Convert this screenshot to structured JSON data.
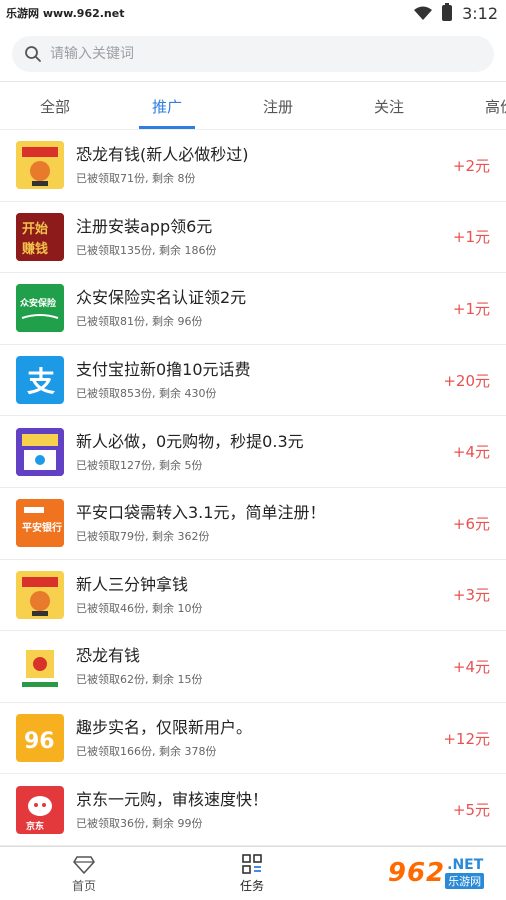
{
  "status": {
    "watermark_left": "乐游网 www.962.net",
    "time": "3:12"
  },
  "search": {
    "placeholder": "请输入关键词"
  },
  "tabs": [
    {
      "label": "全部"
    },
    {
      "label": "推广"
    },
    {
      "label": "注册"
    },
    {
      "label": "关注"
    },
    {
      "label": "高价"
    }
  ],
  "items": [
    {
      "title": "恐龙有钱(新人必做秒过)",
      "sub": "已被领取71份, 剩余 8份",
      "reward": "+2元",
      "thumb": "dino-icon"
    },
    {
      "title": "注册安装app领6元",
      "sub": "已被领取135份, 剩余 186份",
      "reward": "+1元",
      "thumb": "kaishi-icon"
    },
    {
      "title": "众安保险实名认证领2元",
      "sub": "已被领取81份, 剩余 96份",
      "reward": "+1元",
      "thumb": "zhongan-icon"
    },
    {
      "title": "支付宝拉新0撸10元话费",
      "sub": "已被领取853份, 剩余 430份",
      "reward": "+20元",
      "thumb": "alipay-icon"
    },
    {
      "title": "新人必做，0元购物，秒提0.3元",
      "sub": "已被领取127份, 剩余 5份",
      "reward": "+4元",
      "thumb": "shop-icon"
    },
    {
      "title": "平安口袋需转入3.1元，简单注册！",
      "sub": "已被领取79份, 剩余 362份",
      "reward": "+6元",
      "thumb": "pingan-icon"
    },
    {
      "title": "新人三分钟拿钱",
      "sub": "已被领取46份, 剩余 10份",
      "reward": "+3元",
      "thumb": "dino-icon"
    },
    {
      "title": "恐龙有钱",
      "sub": "已被领取62份, 剩余 15份",
      "reward": "+4元",
      "thumb": "dino-icon"
    },
    {
      "title": "趣步实名，仅限新用户。",
      "sub": "已被领取166份, 剩余 378份",
      "reward": "+12元",
      "thumb": "qubu-icon"
    },
    {
      "title": "京东一元购，审核速度快！",
      "sub": "已被领取36份, 剩余 99份",
      "reward": "+5元",
      "thumb": "jd-icon"
    }
  ],
  "nav": [
    {
      "label": "首页",
      "icon": "diamond-icon"
    },
    {
      "label": "任务",
      "icon": "task-grid-icon"
    }
  ],
  "watermark": {
    "big": "962",
    "net": ".NET",
    "sub": "乐游网"
  },
  "colors": {
    "accent": "#2f7de1",
    "reward": "#e95151"
  }
}
